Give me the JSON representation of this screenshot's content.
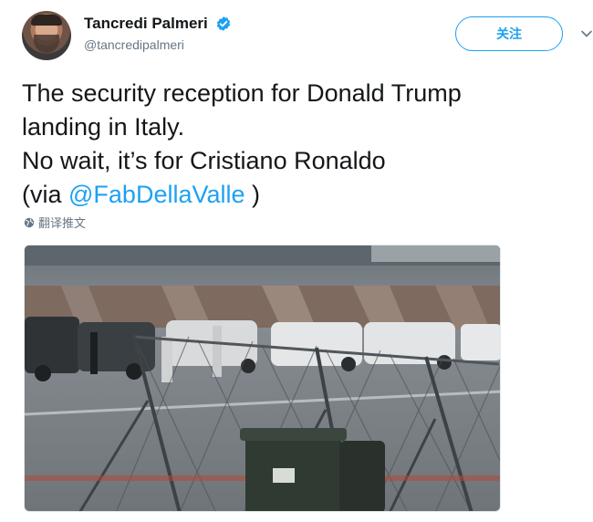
{
  "author": {
    "display_name": "Tancredi Palmeri",
    "handle": "@tancredipalmeri",
    "verified": true
  },
  "actions": {
    "follow_label": "关注"
  },
  "tweet": {
    "line1": "The security reception for Donald Trump",
    "line2": "landing in Italy.",
    "line3": "No wait, it’s for Cristiano Ronaldo",
    "line4_prefix": "(via ",
    "mention": "@FabDellaValle",
    "line4_suffix": " )"
  },
  "translate_label": "翻译推文",
  "icons": {
    "verified": "verified-badge-icon",
    "caret": "chevron-down-icon",
    "globe": "globe-icon"
  },
  "colors": {
    "accent": "#1da1f2",
    "text": "#14171a",
    "muted": "#657786"
  }
}
